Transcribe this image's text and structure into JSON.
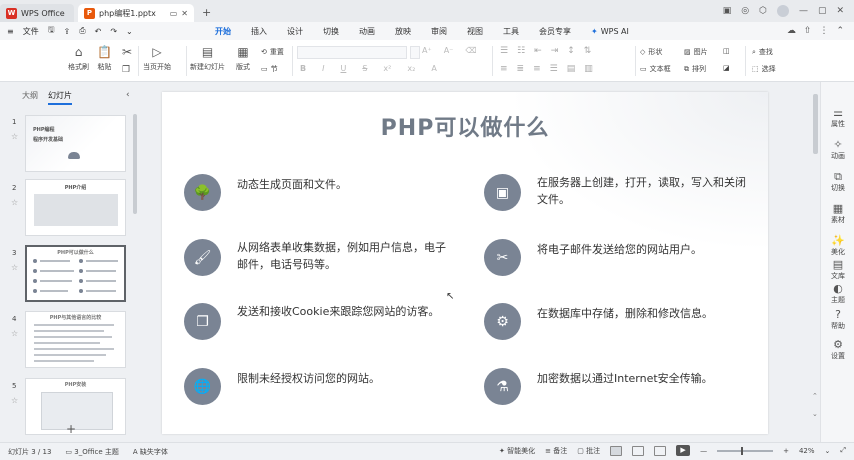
{
  "titlebar": {
    "home_tab": "WPS Office",
    "doc_tab": "php编程1.pptx",
    "new_tab_icon": "plus-icon"
  },
  "menubar": {
    "file": "文件",
    "tabs": [
      "开始",
      "插入",
      "设计",
      "切换",
      "动画",
      "放映",
      "审阅",
      "视图",
      "工具",
      "会员专享"
    ],
    "active_tab": "开始",
    "wps_ai": "WPS AI"
  },
  "ribbon": {
    "format_painter": "格式刷",
    "paste": "粘贴",
    "play_from_current": "当页开始",
    "new_slide": "新建幻灯片",
    "layout": "版式",
    "section": "节",
    "reset": "重置",
    "shape": "形状",
    "picture": "图片",
    "find": "查找",
    "textbox": "文本框",
    "arrange": "排列",
    "select": "选择"
  },
  "left_panel": {
    "tab_outline": "大纲",
    "tab_slides": "幻灯片",
    "thumbs": [
      {
        "num": "1",
        "title": "PHP编程",
        "subtitle": "程序开发基础"
      },
      {
        "num": "2",
        "title": "PHP介绍"
      },
      {
        "num": "3",
        "title": "PHP可以做什么"
      },
      {
        "num": "4",
        "title": "PHP与其他语言的比较"
      },
      {
        "num": "5",
        "title": "PHP安装"
      }
    ]
  },
  "slide": {
    "title": "PHP可以做什么",
    "items": [
      {
        "text": "动态生成页面和文件。",
        "icon": "tree-icon"
      },
      {
        "text": "在服务器上创建，打开，读取，写入和关闭文件。",
        "icon": "box-icon"
      },
      {
        "text": "从网络表单收集数据，例如用户信息，电子邮件，电话号码等。",
        "icon": "brush-icon"
      },
      {
        "text": "将电子邮件发送给您的网站用户。",
        "icon": "scissors-icon"
      },
      {
        "text": "发送和接收Cookie来跟踪您网站的访客。",
        "icon": "copy-icon"
      },
      {
        "text": "在数据库中存储，删除和修改信息。",
        "icon": "gear-icon"
      },
      {
        "text": "限制未经授权访问您的网站。",
        "icon": "globe-icon"
      },
      {
        "text": "加密数据以通过Internet安全传输。",
        "icon": "flask-icon"
      }
    ]
  },
  "right_toolbar": {
    "items": [
      "属性",
      "动画",
      "切换",
      "素材",
      "美化",
      "文库",
      "主题",
      "帮助",
      "设置"
    ]
  },
  "statusbar": {
    "slide_counter": "幻灯片 3 / 13",
    "theme": "3_Office 主题",
    "missing_font": "缺失字体",
    "smart_beautify": "智能美化",
    "notes": "备注",
    "comments": "批注",
    "zoom": "42%",
    "zoom_fraction": 0.42
  }
}
